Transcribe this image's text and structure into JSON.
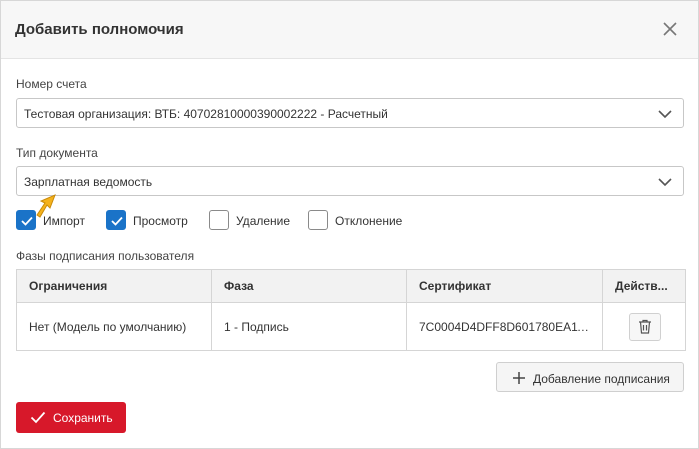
{
  "dialog": {
    "title": "Добавить полномочия"
  },
  "account": {
    "label": "Номер счета",
    "value": "Тестовая организация: ВТБ: 40702810000390002222 - Расчетный"
  },
  "doc_type": {
    "label": "Тип документа",
    "value": "Зарплатная ведомость"
  },
  "permissions": [
    {
      "label": "Импорт",
      "checked": true
    },
    {
      "label": "Просмотр",
      "checked": true
    },
    {
      "label": "Удаление",
      "checked": false
    },
    {
      "label": "Отклонение",
      "checked": false
    }
  ],
  "signing": {
    "label": "Фазы подписания пользователя",
    "columns": [
      "Ограничения",
      "Фаза",
      "Сертификат",
      "Действ..."
    ],
    "rows": [
      [
        "Нет (Модель по умолчанию)",
        "1 - Подпись",
        "7C0004D4DFF8D601780EA113..."
      ]
    ],
    "add_label": "Добавление подписания"
  },
  "footer": {
    "save_label": "Сохранить"
  },
  "icons": {
    "close": "close-icon",
    "chevron": "chevron-down-icon",
    "check": "check-icon",
    "trash": "trash-icon",
    "plus": "plus-icon",
    "cursor": "pointer-arrow-icon"
  },
  "colors": {
    "accent_blue": "#1a73c8",
    "primary_red": "#d7182a",
    "cursor_yellow": "#f5b21b"
  }
}
